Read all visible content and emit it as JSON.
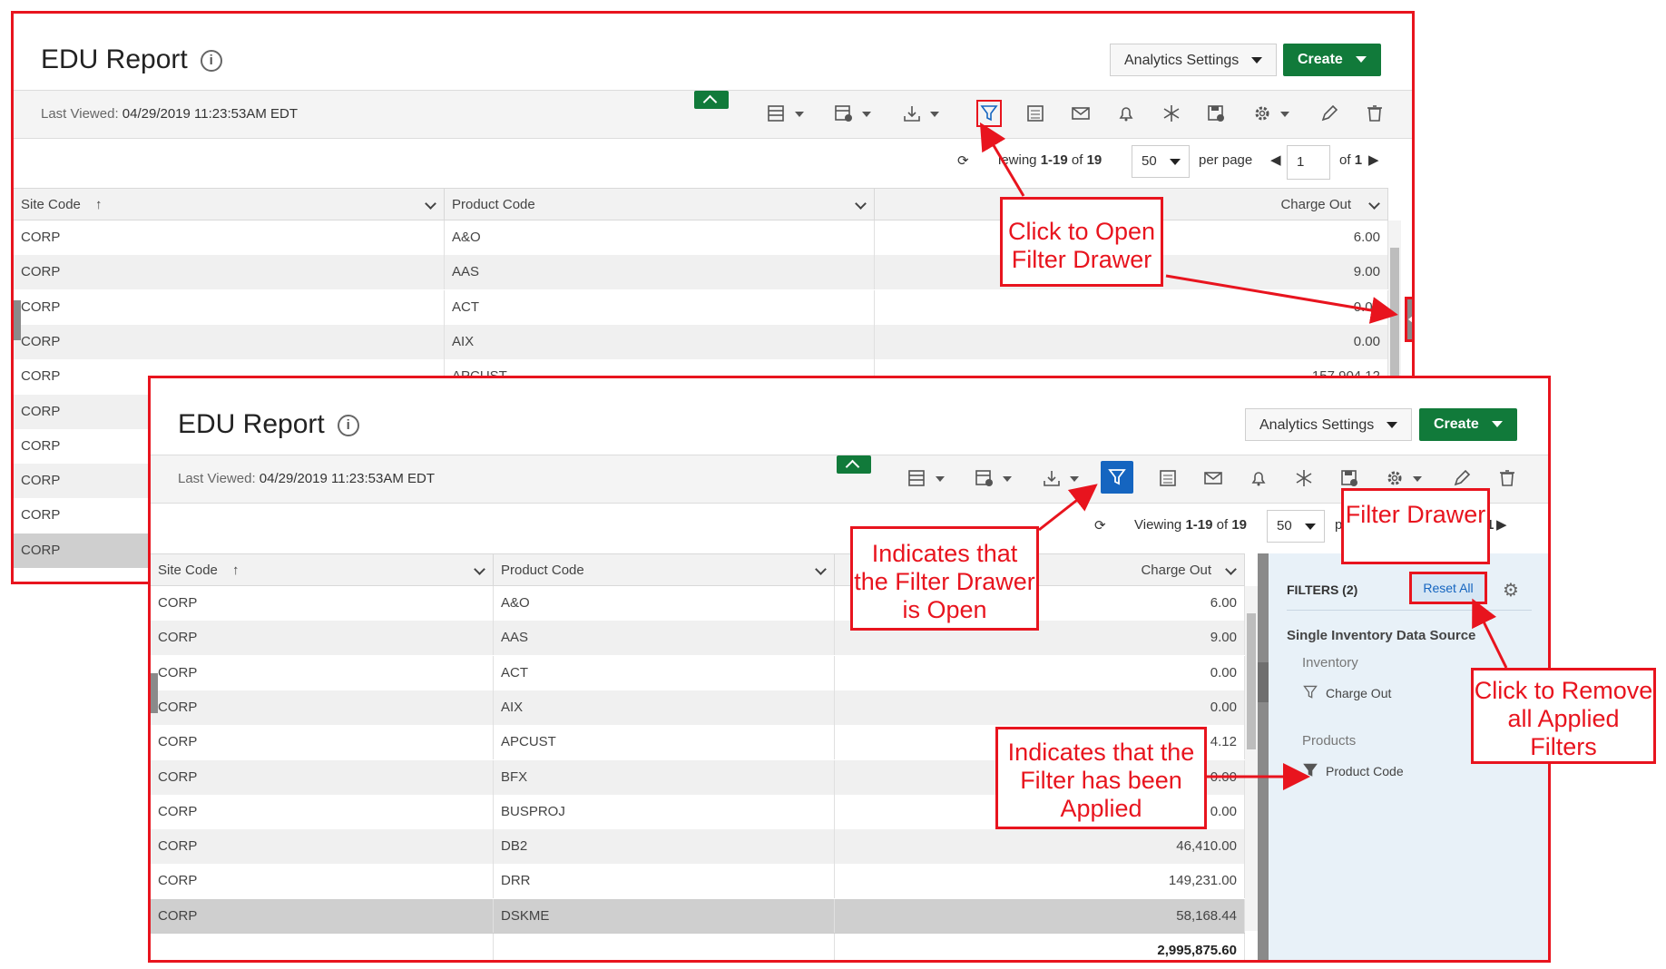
{
  "report": {
    "title": "EDU Report",
    "info_icon": "info-circle-icon",
    "analytics_settings": "Analytics Settings",
    "create": "Create",
    "last_viewed_label": "Last Viewed:",
    "last_viewed_value": "04/29/2019 11:23:53AM EDT"
  },
  "pager": {
    "viewing_prefix": "Viewing",
    "range": "1-19",
    "of_label": "of",
    "total": "19",
    "viewing_partial": "iewing",
    "per_page_value": "50",
    "per_page_label": "per page",
    "per_page_partial": "pe",
    "page_value": "1",
    "page_of": "of",
    "page_total": "1"
  },
  "columns": {
    "site": "Site Code",
    "product": "Product Code",
    "charge": "Charge Out"
  },
  "rows_top": [
    {
      "site": "CORP",
      "product": "A&O",
      "charge": "6.00"
    },
    {
      "site": "CORP",
      "product": "AAS",
      "charge": "9.00"
    },
    {
      "site": "CORP",
      "product": "ACT",
      "charge": "0.00"
    },
    {
      "site": "CORP",
      "product": "AIX",
      "charge": "0.00"
    },
    {
      "site": "CORP",
      "product": "APCUST",
      "charge": "157,904.12"
    },
    {
      "site": "CORP",
      "product": "",
      "charge": ""
    },
    {
      "site": "CORP",
      "product": "",
      "charge": ""
    },
    {
      "site": "CORP",
      "product": "",
      "charge": ""
    },
    {
      "site": "CORP",
      "product": "",
      "charge": ""
    },
    {
      "site": "CORP",
      "product": "",
      "charge": ""
    }
  ],
  "rows_bottom": [
    {
      "site": "CORP",
      "product": "A&O",
      "charge": "6.00"
    },
    {
      "site": "CORP",
      "product": "AAS",
      "charge": "9.00"
    },
    {
      "site": "CORP",
      "product": "ACT",
      "charge": "0.00"
    },
    {
      "site": "CORP",
      "product": "AIX",
      "charge": "0.00"
    },
    {
      "site": "CORP",
      "product": "APCUST",
      "charge": "4.12"
    },
    {
      "site": "CORP",
      "product": "BFX",
      "charge": "0.00"
    },
    {
      "site": "CORP",
      "product": "BUSPROJ",
      "charge": "0.00"
    },
    {
      "site": "CORP",
      "product": "DB2",
      "charge": "46,410.00"
    },
    {
      "site": "CORP",
      "product": "DRR",
      "charge": "149,231.00"
    },
    {
      "site": "CORP",
      "product": "DSKME",
      "charge": "58,168.44"
    }
  ],
  "grand_total": "2,995,875.60",
  "filters": {
    "header": "FILTERS (2)",
    "reset_all": "Reset All",
    "source": "Single Inventory Data Source",
    "group1": "Inventory",
    "filter1": "Charge Out",
    "group2": "Products",
    "filter2": "Product Code"
  },
  "callouts": {
    "open_drawer": "Click to Open Filter Drawer",
    "drawer_open": "Indicates that the Filter Drawer is Open",
    "filter_drawer": "Filter Drawer",
    "remove_filters": "Click to Remove all Applied Filters",
    "filter_applied": "Indicates that the Filter has been Applied"
  },
  "colors": {
    "callout": "#e8141e",
    "create_green": "#117a3a",
    "filter_active_blue": "#1565c0",
    "drawer_bg": "#e8f1f8"
  }
}
